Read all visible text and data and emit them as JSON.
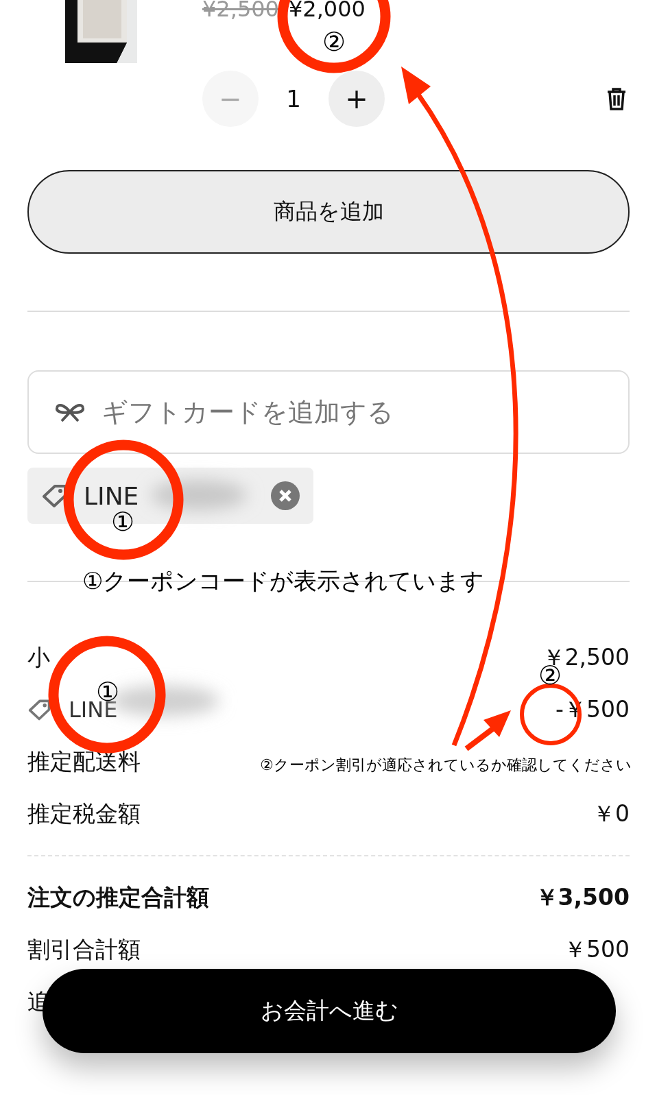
{
  "product": {
    "original_price": "¥2,500",
    "sale_price": "¥2,000",
    "minus": "−",
    "quantity": "1",
    "plus": "+"
  },
  "add_product_button": "商品を追加",
  "gift_card": {
    "placeholder": "ギフトカードを追加する"
  },
  "coupon_chip": {
    "code": "LINE"
  },
  "summary": {
    "rows": [
      {
        "kind": "line",
        "label": "小",
        "value": "￥2,500"
      },
      {
        "kind": "coupon",
        "label": "LINE",
        "value": "-￥500"
      },
      {
        "kind": "line",
        "label": "推定配送料"
      },
      {
        "kind": "line",
        "label": "推定税金額",
        "value": "￥0"
      },
      {
        "kind": "divider"
      },
      {
        "kind": "total",
        "label": "注文の推定合計額",
        "value": "￥3,500"
      },
      {
        "kind": "line",
        "label": "割引合計額",
        "value": "￥500"
      },
      {
        "kind": "line",
        "label": "追"
      }
    ]
  },
  "checkout_button": "お会計へ進む",
  "annotations": [
    {
      "kind": "number",
      "text": "②"
    },
    {
      "kind": "number",
      "text": "①"
    },
    {
      "kind": "note",
      "text": "①クーポンコードが表示されています"
    },
    {
      "kind": "number",
      "text": "①"
    },
    {
      "kind": "number",
      "text": "②"
    },
    {
      "kind": "note",
      "text": "②クーポン割引が適応されているか確認してください"
    }
  ]
}
